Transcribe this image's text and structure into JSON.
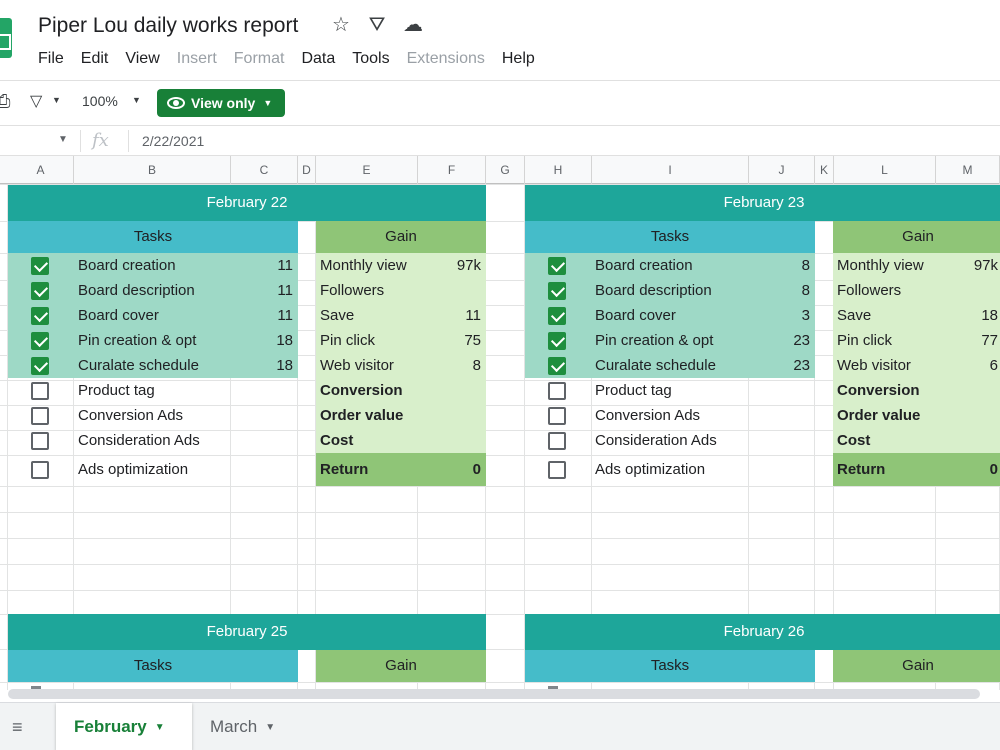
{
  "app": {
    "title": "Piper Lou daily works report",
    "star_icon": "star-icon",
    "move_icon": "drive-move-icon",
    "cloud_icon": "cloud-status-icon"
  },
  "menu": [
    "File",
    "Edit",
    "View",
    "Insert",
    "Format",
    "Data",
    "Tools",
    "Extensions",
    "Help"
  ],
  "menu_disabled": [
    "Insert",
    "Format",
    "Extensions"
  ],
  "toolbar": {
    "zoom": "100%",
    "view_only_label": "View only"
  },
  "formula_bar": {
    "value": "2/22/2021"
  },
  "columns": [
    "A",
    "B",
    "C",
    "D",
    "E",
    "F",
    "G",
    "H",
    "I",
    "J",
    "K",
    "L",
    "M"
  ],
  "colors": {
    "banner": "#1ea69a",
    "tasks_header": "#45bcc9",
    "gain_header": "#8fc577",
    "task_done": "#9ed9c6",
    "gain_light": "#d8efcb",
    "return_fill": "#8fc577",
    "checkbox_checked": "#1e8e3e",
    "view_only_button": "#188038"
  },
  "blocks_top": [
    {
      "date": "February 22",
      "tasks_label": "Tasks",
      "gain_label": "Gain",
      "tasks": [
        {
          "name": "Board creation",
          "value": "11",
          "done": true
        },
        {
          "name": "Board description",
          "value": "11",
          "done": true
        },
        {
          "name": "Board cover",
          "value": "11",
          "done": true
        },
        {
          "name": "Pin creation & opt",
          "value": "18",
          "done": true
        },
        {
          "name": "Curalate schedule",
          "value": "18",
          "done": true
        },
        {
          "name": "Product tag",
          "value": "",
          "done": false
        },
        {
          "name": "Conversion Ads",
          "value": "",
          "done": false
        },
        {
          "name": "Consideration Ads",
          "value": "",
          "done": false
        },
        {
          "name": "Ads optimization",
          "value": "",
          "done": false
        }
      ],
      "gain": [
        {
          "name": "Monthly view",
          "value": "97k"
        },
        {
          "name": "Followers",
          "value": ""
        },
        {
          "name": "Save",
          "value": "11"
        },
        {
          "name": "Pin click",
          "value": "75"
        },
        {
          "name": "Web visitor",
          "value": "8"
        },
        {
          "name": "Conversion",
          "value": ""
        },
        {
          "name": "Order value",
          "value": ""
        },
        {
          "name": "Cost",
          "value": ""
        },
        {
          "name": "Return",
          "value": "0"
        }
      ]
    },
    {
      "date": "February 23",
      "tasks_label": "Tasks",
      "gain_label": "Gain",
      "tasks": [
        {
          "name": "Board creation",
          "value": "8",
          "done": true
        },
        {
          "name": "Board description",
          "value": "8",
          "done": true
        },
        {
          "name": "Board cover",
          "value": "3",
          "done": true
        },
        {
          "name": "Pin creation & opt",
          "value": "23",
          "done": true
        },
        {
          "name": "Curalate schedule",
          "value": "23",
          "done": true
        },
        {
          "name": "Product tag",
          "value": "",
          "done": false
        },
        {
          "name": "Conversion Ads",
          "value": "",
          "done": false
        },
        {
          "name": "Consideration Ads",
          "value": "",
          "done": false
        },
        {
          "name": "Ads optimization",
          "value": "",
          "done": false
        }
      ],
      "gain": [
        {
          "name": "Monthly view",
          "value": "97k"
        },
        {
          "name": "Followers",
          "value": ""
        },
        {
          "name": "Save",
          "value": "18"
        },
        {
          "name": "Pin click",
          "value": "77"
        },
        {
          "name": "Web visitor",
          "value": "6"
        },
        {
          "name": "Conversion",
          "value": ""
        },
        {
          "name": "Order value",
          "value": ""
        },
        {
          "name": "Cost",
          "value": ""
        },
        {
          "name": "Return",
          "value": "0"
        }
      ]
    }
  ],
  "blocks_bottom": [
    {
      "date": "February 25",
      "tasks_label": "Tasks",
      "gain_label": "Gain"
    },
    {
      "date": "February 26",
      "tasks_label": "Tasks",
      "gain_label": "Gain"
    }
  ],
  "sheets": [
    {
      "name": "February",
      "active": true
    },
    {
      "name": "March",
      "active": false
    }
  ]
}
